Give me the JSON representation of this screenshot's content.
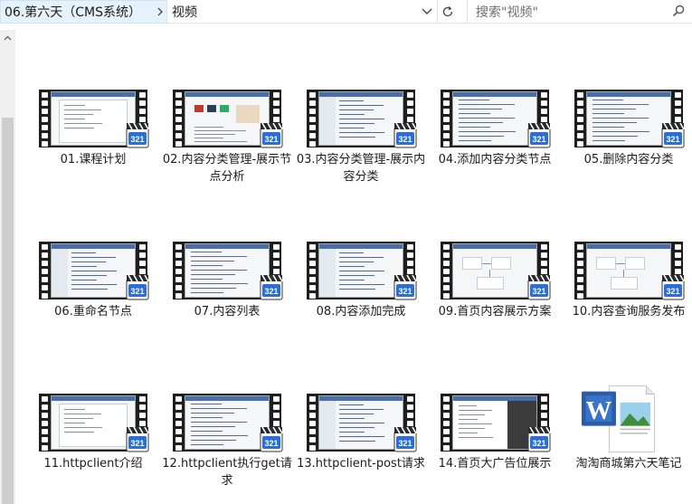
{
  "window": {
    "path_parent": "06.第六天（CMS系统）",
    "path_current": "视频",
    "search_placeholder": "搜索\"视频\""
  },
  "icons": {
    "chevron": "chevron-right-icon",
    "dropdown": "chevron-down-icon",
    "refresh": "refresh-icon",
    "search": "search-icon",
    "video": "video-file-icon",
    "word": "word-document-icon"
  },
  "files": [
    {
      "label": "01.课程计划",
      "type": "video",
      "style": "doc"
    },
    {
      "label": "02.内容分类管理-展示节点分析",
      "type": "video",
      "style": "web"
    },
    {
      "label": "03.内容分类管理-展示内容分类",
      "type": "video",
      "style": "ide"
    },
    {
      "label": "04.添加内容分类节点",
      "type": "video",
      "style": "code"
    },
    {
      "label": "05.删除内容分类",
      "type": "video",
      "style": "code"
    },
    {
      "label": "06.重命名节点",
      "type": "video",
      "style": "ide"
    },
    {
      "label": "07.内容列表",
      "type": "video",
      "style": "code"
    },
    {
      "label": "08.内容添加完成",
      "type": "video",
      "style": "ide"
    },
    {
      "label": "09.首页内容展示方案",
      "type": "video",
      "style": "diagram"
    },
    {
      "label": "10.内容查询服务发布",
      "type": "video",
      "style": "diagram"
    },
    {
      "label": "11.httpclient介绍",
      "type": "video",
      "style": "doc"
    },
    {
      "label": "12.httpclient执行get请求",
      "type": "video",
      "style": "code"
    },
    {
      "label": "13.httpclient-post请求",
      "type": "video",
      "style": "ide"
    },
    {
      "label": "14.首页大广告位展示",
      "type": "video",
      "style": "dark"
    },
    {
      "label": "淘淘商城第六天笔记",
      "type": "word",
      "style": "word"
    }
  ]
}
